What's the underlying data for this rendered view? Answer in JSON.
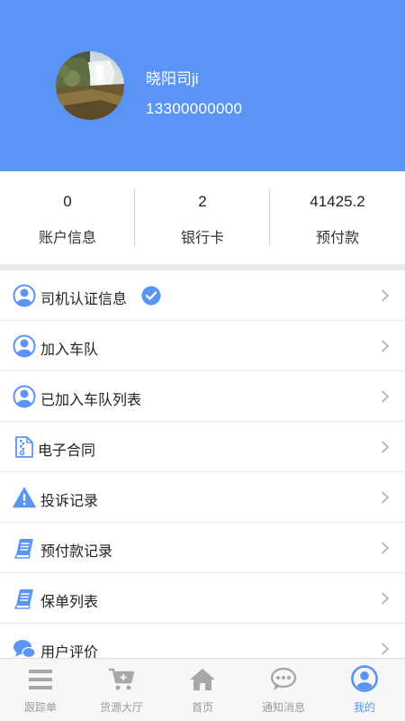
{
  "profile": {
    "name": "晓阳司ji",
    "phone": "13300000000"
  },
  "stats": [
    {
      "value": "0",
      "label": "账户信息"
    },
    {
      "value": "2",
      "label": "银行卡"
    },
    {
      "value": "41425.2",
      "label": "预付款"
    }
  ],
  "menu": [
    {
      "label": "司机认证信息",
      "icon": "user-circle-icon",
      "verified": true
    },
    {
      "label": "加入车队",
      "icon": "user-circle-icon"
    },
    {
      "label": "已加入车队列表",
      "icon": "user-circle-icon"
    },
    {
      "label": "电子合同",
      "icon": "contract-file-icon"
    },
    {
      "label": "投诉记录",
      "icon": "warning-icon"
    },
    {
      "label": "预付款记录",
      "icon": "book-icon"
    },
    {
      "label": "保单列表",
      "icon": "book-icon"
    },
    {
      "label": "用户评价",
      "icon": "chat-bubbles-icon"
    }
  ],
  "tabs": [
    {
      "label": "跟踪单",
      "icon": "list-icon"
    },
    {
      "label": "货源大厅",
      "icon": "cart-plus-icon"
    },
    {
      "label": "首页",
      "icon": "home-icon"
    },
    {
      "label": "通知消息",
      "icon": "message-icon"
    },
    {
      "label": "我的",
      "icon": "user-avatar-icon",
      "active": true
    }
  ],
  "colors": {
    "brand": "#5a95f5",
    "tab_inactive": "#9a9a9a"
  }
}
